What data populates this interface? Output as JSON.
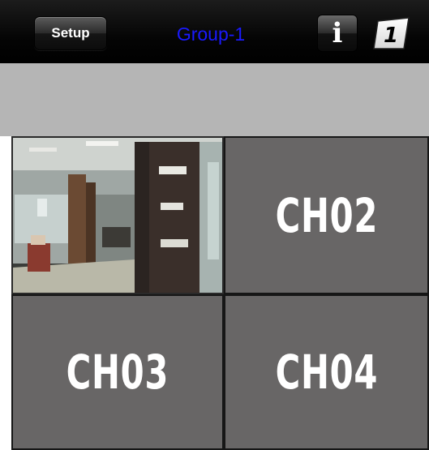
{
  "navbar": {
    "setup_label": "Setup",
    "title": "Group-1",
    "info_icon": "info-icon",
    "info_glyph": "i",
    "single_view_icon": "single-channel-icon",
    "single_view_glyph": "1",
    "title_color": "#1a1aff"
  },
  "grid": {
    "channels": [
      {
        "label": "",
        "state": "live-video"
      },
      {
        "label": "CH02",
        "state": "no-video"
      },
      {
        "label": "CH03",
        "state": "no-video"
      },
      {
        "label": "CH04",
        "state": "no-video"
      }
    ]
  }
}
